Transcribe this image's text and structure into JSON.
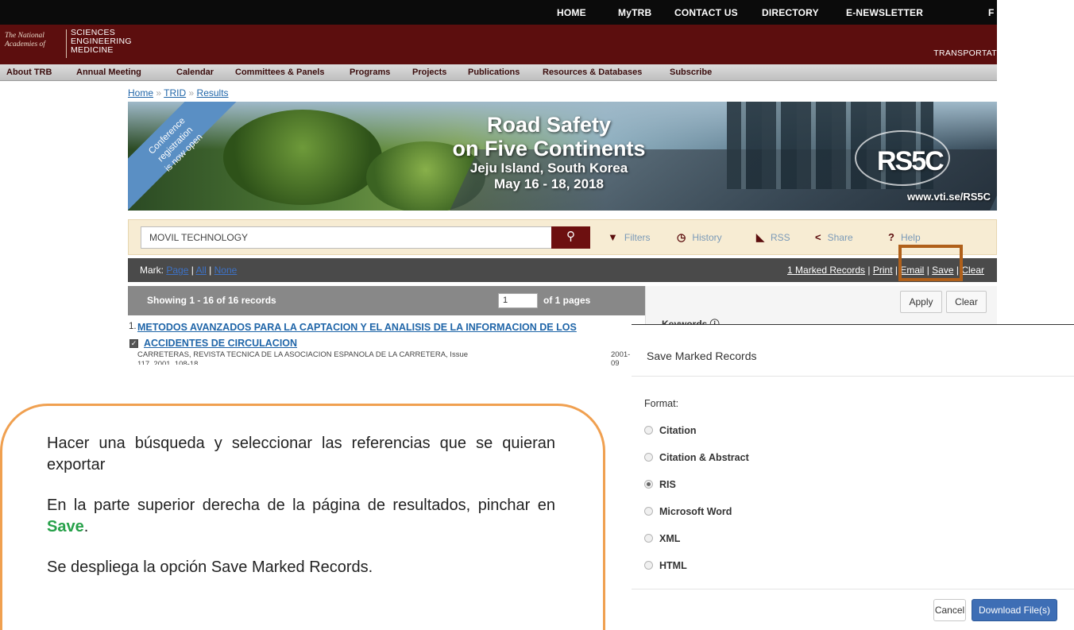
{
  "topnav": {
    "items": [
      "HOME",
      "MyTRB",
      "CONTACT US",
      "DIRECTORY",
      "E-NEWSLETTER",
      "F"
    ]
  },
  "brand": {
    "nas_line1": "The National",
    "nas_line2": "Academies of",
    "words": [
      "SCIENCES",
      "ENGINEERING",
      "MEDICINE"
    ],
    "right_text": "TRANSPORTAT"
  },
  "menubar": {
    "items": [
      "About TRB",
      "Annual Meeting",
      "Calendar",
      "Committees & Panels",
      "Programs",
      "Projects",
      "Publications",
      "Resources & Databases",
      "Subscribe"
    ]
  },
  "breadcrumb": {
    "items": [
      "Home",
      "TRID",
      "Results"
    ],
    "separator": "»"
  },
  "banner": {
    "ribbon": [
      "Conference",
      "registration",
      "is now open"
    ],
    "title_line1": "Road Safety",
    "title_line2": "on Five Continents",
    "location": "Jeju Island, South Korea",
    "dates": "May 16 - 18, 2018",
    "logo": "RS5C",
    "url": "www.vti.se/RS5C"
  },
  "search": {
    "value": "MOVIL TECHNOLOGY",
    "tools": [
      {
        "label": "Filters",
        "icon": "filter-icon",
        "glyph": "▼"
      },
      {
        "label": "History",
        "icon": "clock-icon",
        "glyph": "◷"
      },
      {
        "label": "RSS",
        "icon": "rss-icon",
        "glyph": "◣"
      },
      {
        "label": "Share",
        "icon": "share-icon",
        "glyph": "<"
      },
      {
        "label": "Help",
        "icon": "help-icon",
        "glyph": "?"
      }
    ]
  },
  "markbar": {
    "label": "Mark:",
    "links": [
      "Page",
      "All",
      "None"
    ],
    "right_links": [
      "1 Marked Records",
      "Print",
      "Email",
      "Save",
      "Clear"
    ]
  },
  "results_header": {
    "showing": "Showing 1 - 16 of 16 records",
    "page_value": "1",
    "of_pages": "of 1 pages"
  },
  "right_panel": {
    "apply": "Apply",
    "clear": "Clear",
    "keywords": "Keywords ⓘ"
  },
  "result": {
    "number": "1.",
    "title_line1": "METODOS AVANZADOS PARA LA CAPTACION Y EL ANALISIS DE LA INFORMACION DE LOS",
    "title_line2": "ACCIDENTES DE CIRCULACION",
    "source_line1": "CARRETERAS, REVISTA TECNICA DE LA ASOCIACION ESPANOLA DE LA CARRETERA, Issue",
    "source_line2": "117, 2001, 108-18",
    "date": "2001-09"
  },
  "modal": {
    "title": "Save Marked Records",
    "format_label": "Format:",
    "options": [
      "Citation",
      "Citation & Abstract",
      "RIS",
      "Microsoft Word",
      "XML",
      "HTML"
    ],
    "selected": "RIS",
    "cancel": "Cancel",
    "download": "Download File(s)"
  },
  "callout": {
    "p1": "Hacer una búsqueda y seleccionar las referencias que se quieran exportar",
    "p2_pre": "En la parte superior derecha de la página de resultados, pinchar en ",
    "p2_save": "Save",
    "p2_post": ".",
    "p3": "Se despliega la opción Save Marked Records."
  },
  "colors": {
    "brand_maroon": "#5c0e0e",
    "link_blue": "#1f65a8",
    "highlight_orange": "#b0601a",
    "callout_border": "#f0a050",
    "save_green": "#27a14a",
    "download_blue": "#3e6eb5"
  }
}
